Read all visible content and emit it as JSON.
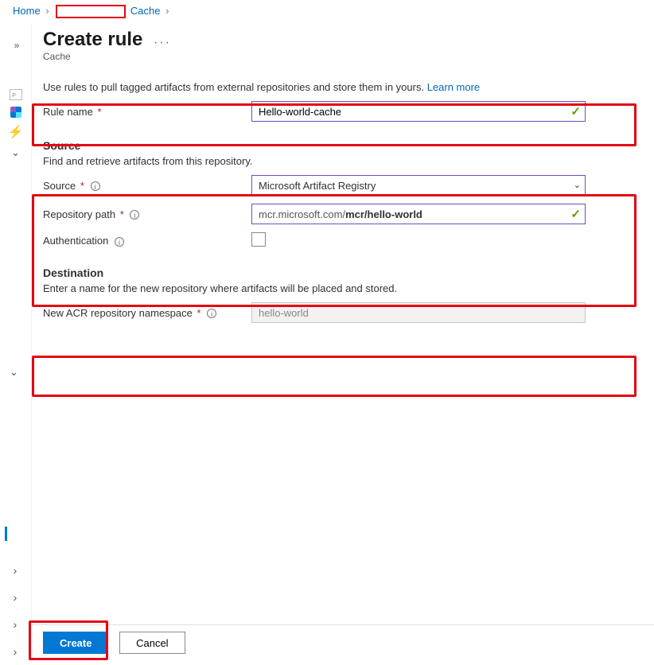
{
  "breadcrumb": {
    "home": "Home",
    "cache": "Cache"
  },
  "page": {
    "title": "Create rule",
    "subtitle": "Cache"
  },
  "intro": {
    "text": "Use rules to pull tagged artifacts from external repositories and store them in yours.",
    "learn_more": "Learn more"
  },
  "fields": {
    "rule_name": {
      "label": "Rule name",
      "value": "Hello-world-cache"
    },
    "source_section": {
      "title": "Source",
      "desc": "Find and retrieve artifacts from this repository."
    },
    "source": {
      "label": "Source",
      "value": "Microsoft Artifact Registry"
    },
    "repo_path": {
      "label": "Repository path",
      "prefix": "mcr.microsoft.com/",
      "value": "mcr/hello-world"
    },
    "auth": {
      "label": "Authentication"
    },
    "dest_section": {
      "title": "Destination",
      "desc": "Enter a name for the new repository where artifacts will be placed and stored."
    },
    "namespace": {
      "label": "New ACR repository namespace",
      "value": "hello-world"
    }
  },
  "footer": {
    "create": "Create",
    "cancel": "Cancel"
  }
}
